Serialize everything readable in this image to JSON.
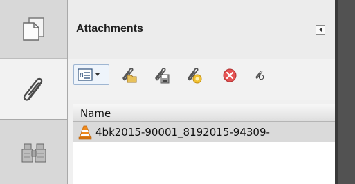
{
  "rail": {
    "items": [
      {
        "name": "pages",
        "icon": "pages-icon"
      },
      {
        "name": "attachments",
        "icon": "paperclip-icon",
        "active": true
      },
      {
        "name": "search",
        "icon": "binoculars-icon"
      }
    ]
  },
  "panel": {
    "title": "Attachments",
    "collapse_icon": "triangle-left-icon"
  },
  "toolbar": {
    "buttons": [
      {
        "name": "options",
        "icon": "list-options-icon"
      },
      {
        "name": "open-file",
        "icon": "paperclip-folder-icon"
      },
      {
        "name": "save-file",
        "icon": "paperclip-save-icon"
      },
      {
        "name": "add-file",
        "icon": "paperclip-add-icon"
      },
      {
        "name": "delete-file",
        "icon": "delete-x-icon"
      },
      {
        "name": "search-attachments",
        "icon": "paperclip-search-icon"
      }
    ]
  },
  "list": {
    "columns": [
      "Name"
    ],
    "rows": [
      {
        "name": "4bk2015-90001_8192015-94309-",
        "icon": "vlc-cone-icon",
        "selected": true
      }
    ]
  },
  "colors": {
    "rail": "#dcdcdc",
    "panel": "#f0f0f0",
    "selected_row": "#dadada",
    "dark_strip": "#525252"
  }
}
